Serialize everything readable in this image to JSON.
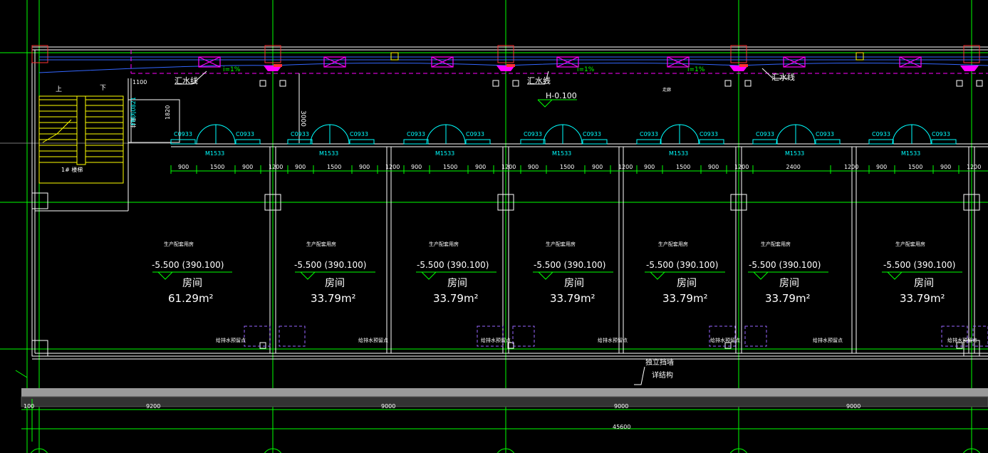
{
  "colors": {
    "background": "#000000",
    "grid_axis": "#00ff00",
    "wall": "#ffffff",
    "door": "#00ffff",
    "stair": "#ffff00",
    "equipment": "#ff00ff",
    "column": "#ff3333",
    "drain": "#3366ff",
    "ground": "#9a9a9a"
  },
  "corridor": {
    "slope_label": "i=1%",
    "drain_label": "汇水线",
    "elevation": "H-0.100",
    "dim_3000": "3000",
    "dim_1100": "1100",
    "corridor_label": "走廊"
  },
  "stair": {
    "up": "上",
    "down": "下",
    "label": "1# 楼梯"
  },
  "elevator": {
    "label": "电井",
    "door_label": "FM丙0821",
    "dim": "1820"
  },
  "doors": {
    "window_label": "C0933",
    "door_label": "M1533"
  },
  "dimensions_row": {
    "segments": [
      "900",
      "1500",
      "900",
      "1200",
      "900",
      "1500",
      "900",
      "1200",
      "900",
      "1500",
      "900",
      "1200",
      "900",
      "1500",
      "900",
      "1200",
      "900",
      "1500",
      "900",
      "1200",
      "2400",
      "1200",
      "900",
      "1500",
      "900",
      "1200"
    ]
  },
  "rooms": [
    {
      "use": "生产配套用房",
      "level": "-5.500",
      "abs": "(390.100)",
      "name": "房间",
      "area": "61.29m²",
      "note": "给排水预留点"
    },
    {
      "use": "生产配套用房",
      "level": "-5.500",
      "abs": "(390.100)",
      "name": "房间",
      "area": "33.79m²",
      "note": "给排水预留点"
    },
    {
      "use": "生产配套用房",
      "level": "-5.500",
      "abs": "(390.100)",
      "name": "房间",
      "area": "33.79m²",
      "note": "给排水预留点"
    },
    {
      "use": "生产配套用房",
      "level": "-5.500",
      "abs": "(390.100)",
      "name": "房间",
      "area": "33.79m²",
      "note": "给排水预留点"
    },
    {
      "use": "生产配套用房",
      "level": "-5.500",
      "abs": "(390.100)",
      "name": "房间",
      "area": "33.79m²",
      "note": "给排水预留点"
    },
    {
      "use": "生产配套用房",
      "level": "-5.500",
      "abs": "(390.100)",
      "name": "房间",
      "area": "33.79m²",
      "note": "给排水预留点"
    },
    {
      "use": "生产配套用房",
      "level": "-5.500",
      "abs": "(390.100)",
      "name": "房间",
      "area": "33.79m²",
      "note": "给排水预留点"
    }
  ],
  "bottom": {
    "retaining_wall": "独立挡墙",
    "detail": "详结构",
    "dim_100": "100",
    "dim_9200": "9200",
    "dim_9000": "9000",
    "total": "45600"
  }
}
